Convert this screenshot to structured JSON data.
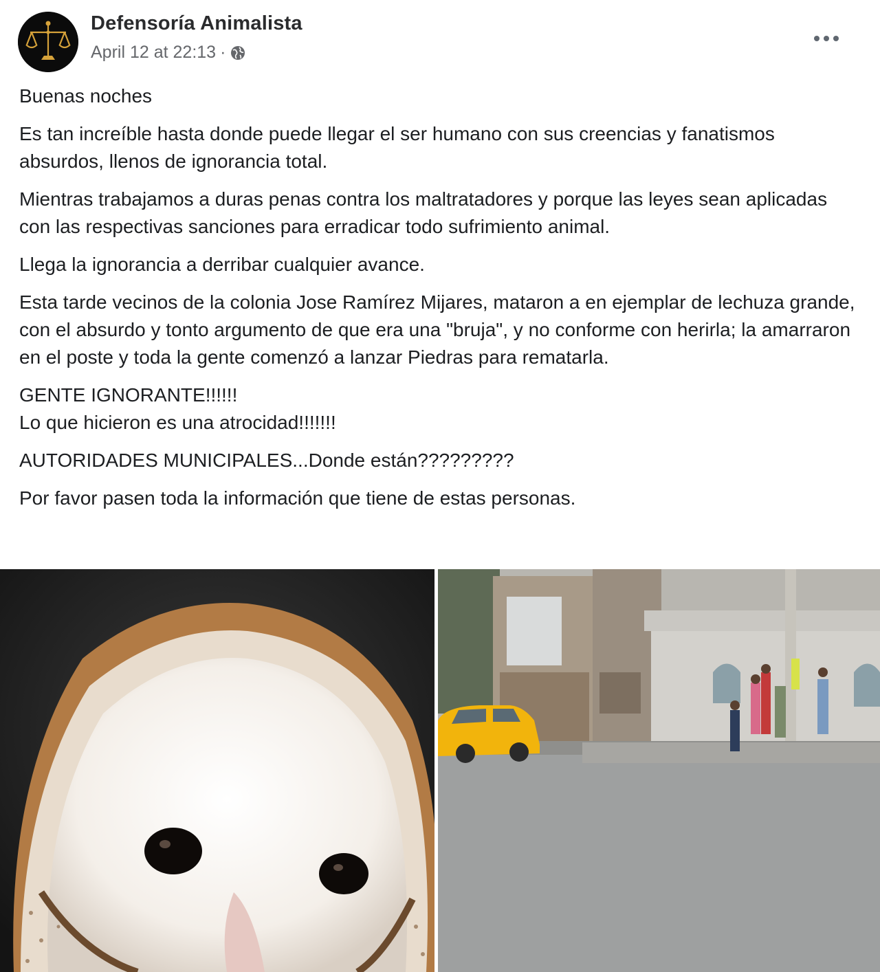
{
  "post": {
    "author": "Defensoría Animalista",
    "timestamp": "April 12 at 22:13",
    "separator": "·",
    "privacy_icon": "globe-icon",
    "more_icon": "more-options-icon",
    "avatar_icon": "scales-of-justice-logo"
  },
  "body": {
    "paragraphs": [
      "Buenas noches",
      "Es tan increíble hasta donde puede llegar el ser humano con sus creencias y fanatismos absurdos, llenos de ignorancia total.",
      "Mientras trabajamos a duras penas contra los maltratadores y porque las leyes sean aplicadas con las respectivas sanciones para erradicar todo sufrimiento animal.",
      "Llega la ignorancia a derribar cualquier avance.",
      "Esta tarde vecinos de la colonia Jose Ramírez Mijares, mataron a en ejemplar de lechuza grande, con el absurdo y tonto argumento de que era una \"bruja\", y no conforme con herirla; la amarraron en el poste y toda la gente comenzó a lanzar Piedras para rematarla.",
      "GENTE IGNORANTE!!!!!!\nLo que hicieron es una atrocidad!!!!!!!",
      "AUTORIDADES MUNICIPALES...Donde están?????????",
      "Por favor pasen toda la información que tiene de estas personas."
    ]
  },
  "photos": [
    {
      "subject": "barn-owl-closeup"
    },
    {
      "subject": "street-scene-yellow-taxi"
    }
  ],
  "colors": {
    "name": "#2a2b2d",
    "meta": "#65676b",
    "text": "#1c1e21",
    "taxi": "#f2b40c"
  }
}
